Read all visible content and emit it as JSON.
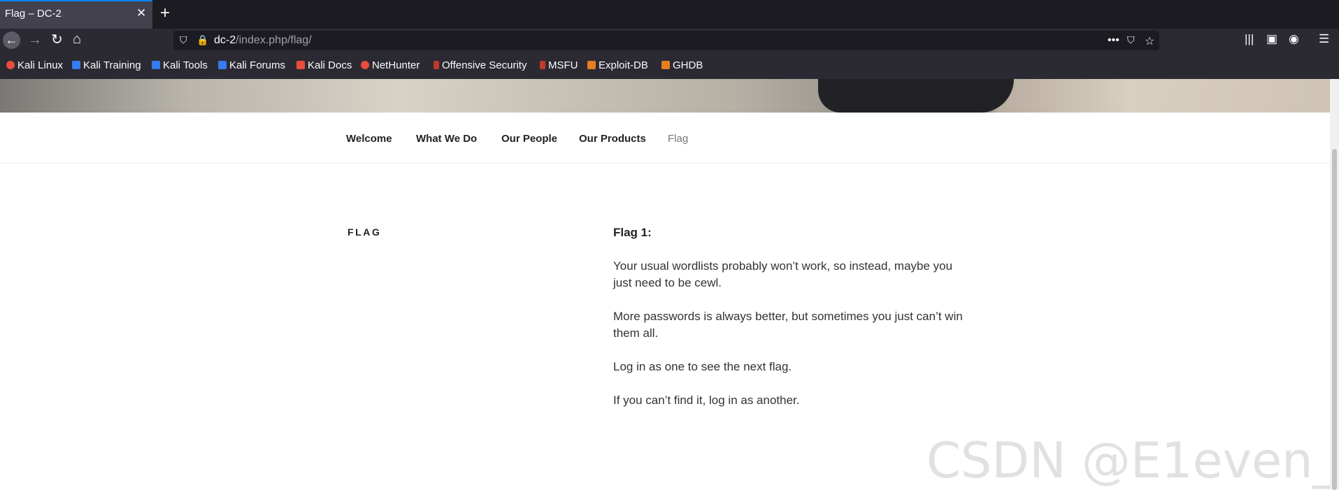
{
  "browser": {
    "tab_title": "Flag – DC-2",
    "tab_close": "✕",
    "new_tab": "+",
    "url_host": "dc-2",
    "url_path": "/index.php/flag/",
    "bookmarks": [
      {
        "label": "Kali Linux",
        "icon": "kali-icon",
        "color": "#e84c3d"
      },
      {
        "label": "Kali Training",
        "icon": "kali-training-icon",
        "color": "#367bf0"
      },
      {
        "label": "Kali Tools",
        "icon": "kali-tools-icon",
        "color": "#367bf0"
      },
      {
        "label": "Kali Forums",
        "icon": "kali-forums-icon",
        "color": "#367bf0"
      },
      {
        "label": "Kali Docs",
        "icon": "kali-docs-icon",
        "color": "#e84c3d"
      },
      {
        "label": "NetHunter",
        "icon": "nethunter-icon",
        "color": "#e84c3d"
      },
      {
        "label": "Offensive Security",
        "icon": "offsec-icon",
        "color": "#c0392b"
      },
      {
        "label": "MSFU",
        "icon": "msfu-icon",
        "color": "#c0392b"
      },
      {
        "label": "Exploit-DB",
        "icon": "exploit-db-icon",
        "color": "#e67e22"
      },
      {
        "label": "GHDB",
        "icon": "ghdb-icon",
        "color": "#e67e22"
      }
    ]
  },
  "menu": {
    "items": [
      {
        "label": "Welcome"
      },
      {
        "label": "What We Do"
      },
      {
        "label": "Our People"
      },
      {
        "label": "Our Products"
      },
      {
        "label": "Flag"
      }
    ]
  },
  "page": {
    "title": "FLAG",
    "flag_label": "Flag 1:",
    "paragraphs": [
      "Your usual wordlists probably won’t work, so instead, maybe you just need to be cewl.",
      "More passwords is always better, but sometimes you just can’t win them all.",
      "Log in as one to see the next flag.",
      "If you can’t find it, log in as another."
    ]
  },
  "watermark": "CSDN @E1even__",
  "colors": {
    "accent": "#0a84ff",
    "chrome_dark": "#1c1b22",
    "toolbar": "#2b2a33"
  }
}
